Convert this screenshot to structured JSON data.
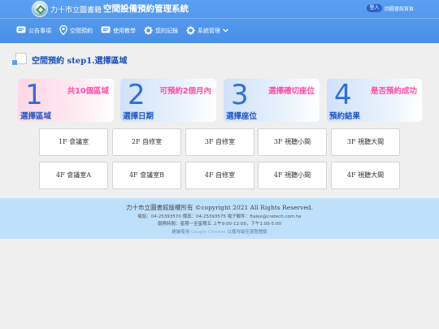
{
  "header": {
    "library_name": "力十市立圖書籍",
    "system_title": "空間設備預約管理系統",
    "login_label": "登入",
    "home_link": "回圖書館首頁"
  },
  "nav": [
    {
      "label": "公告事項",
      "icon": "megaphone-icon"
    },
    {
      "label": "空間預約",
      "icon": "location-pin-icon"
    },
    {
      "label": "使用教學",
      "icon": "chat-icon"
    },
    {
      "label": "您的記錄",
      "icon": "gear-icon"
    },
    {
      "label": "系統管理",
      "icon": "gear-icon"
    }
  ],
  "page": {
    "title": "空間預約 step1.選擇區域"
  },
  "steps": [
    {
      "number": "1",
      "note": "共10個區域",
      "name": "選擇區域"
    },
    {
      "number": "2",
      "note": "可預約2個月內",
      "name": "選擇日期"
    },
    {
      "number": "3",
      "note": "選擇確切座位",
      "name": "選擇座位"
    },
    {
      "number": "4",
      "note": "是否預約成功",
      "name": "預約結果"
    }
  ],
  "rooms": [
    "1F 會議室",
    "2F 自修室",
    "3F 自修室",
    "3F 視聽小間",
    "3F 視聽大間",
    "4F 會議室A",
    "4F 會議室B",
    "4F 自修室",
    "4F 視聽小間",
    "4F 視聽大間"
  ],
  "footer": {
    "copyright": "力十市立圖書館版權所有 ©copyright 2021 All Rights Reserved.",
    "contact": "電話：04-25393570  傳真：04-25393575  電子郵件：ftalex@cretech.com.tw",
    "hours": "服務時間：星期一至星期五 上午9:00-12:00，下午1:00-5:00",
    "browser_note_prefix": "建議使用",
    "browser_note_mid": "Google Chrome",
    "browser_note_suffix": "以獲得最佳瀏覽體驗"
  },
  "colors": {
    "header": "#4a8fe6",
    "title": "#1b4fb8",
    "step_number": "#2f6fd6",
    "step_note": "#ff4da6",
    "footer": "#bfe0fb"
  }
}
